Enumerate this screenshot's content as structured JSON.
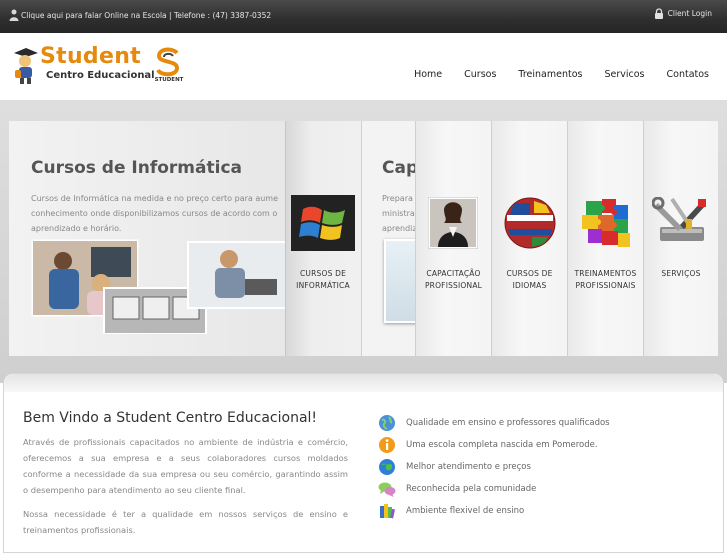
{
  "topbar": {
    "phone_text": "Clique aqui para falar Online na Escola | Telefone : (47) 3387-0352",
    "login_label": "Client Login"
  },
  "logo": {
    "name": "Student",
    "subtitle": "Centro Educacional",
    "mark_text": "STUDENT"
  },
  "nav": [
    "Home",
    "Cursos",
    "Treinamentos",
    "Servicos",
    "Contatos"
  ],
  "slider": {
    "active": {
      "title": "Cursos de Informática",
      "lines": [
        "Cursos de Informática na medida e no preço certo para aume",
        "conhecimento onde disponibilizamos cursos de acordo com o",
        "aprendizado e horário."
      ]
    },
    "next": {
      "title": "Cap",
      "lines": [
        "Prepara",
        "ministra",
        "aprendiz"
      ]
    },
    "tabs": [
      {
        "label_line1": "CURSOS DE",
        "label_line2": "INFORMÁTICA",
        "icon": "windows-logo-icon"
      },
      {
        "label_line1": "CAPACITAÇÃO",
        "label_line2": "PROFISSIONAL",
        "icon": "businesswoman-icon"
      },
      {
        "label_line1": "CURSOS DE",
        "label_line2": "IDIOMAS",
        "icon": "flags-globe-icon"
      },
      {
        "label_line1": "TREINAMENTOS",
        "label_line2": "PROFISSIONAIS",
        "icon": "puzzle-pieces-icon"
      },
      {
        "label_line1": "SERVIÇOS",
        "label_line2": "",
        "icon": "tools-icon"
      }
    ]
  },
  "welcome": {
    "title": "Bem Vindo a Student Centro Educacional!",
    "paragraph1": "Através de profissionais capacitados no ambiente de indústria e comércio, oferecemos a sua empresa e a seus colaboradores cursos moldados conforme a necessidade da sua empresa ou seu comércio, garantindo assim o desempenho para atendimento ao seu cliente final.",
    "paragraph2": "Nossa necessidade é ter a qualidade em nossos serviços de ensino e treinamentos profissionais."
  },
  "features": [
    {
      "text": "Qualidade em ensino e professores qualificados",
      "icon": "globe-icon"
    },
    {
      "text": "Uma escola completa nascida em Pomerode.",
      "icon": "info-icon"
    },
    {
      "text": "Melhor atendimento e preços",
      "icon": "earth-icon"
    },
    {
      "text": "Reconhecida pela comunidade",
      "icon": "chat-bubbles-icon"
    },
    {
      "text": "Ambiente flexivel de ensino",
      "icon": "books-icon"
    }
  ]
}
